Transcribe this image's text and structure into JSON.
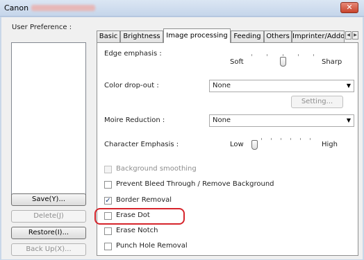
{
  "window": {
    "title": "Canon",
    "close_symbol": "✕"
  },
  "left": {
    "label": "User Preference :",
    "buttons": [
      {
        "label": "Save(Y)...",
        "enabled": true
      },
      {
        "label": "Delete(J)",
        "enabled": false
      },
      {
        "label": "Restore(I)...",
        "enabled": true
      },
      {
        "label": "Back Up(X)...",
        "enabled": false
      }
    ]
  },
  "tabs": [
    {
      "label": "Basic",
      "active": false
    },
    {
      "label": "Brightness",
      "active": false
    },
    {
      "label": "Image processing",
      "active": true
    },
    {
      "label": "Feeding",
      "active": false
    },
    {
      "label": "Others",
      "active": false
    },
    {
      "label": "Imprinter/Addo",
      "active": false
    }
  ],
  "tab_scroll": {
    "left": "◀",
    "right": "▶"
  },
  "panel": {
    "edge_emphasis": {
      "label": "Edge emphasis :",
      "min_label": "Soft",
      "max_label": "Sharp",
      "level": 0.5
    },
    "color_dropout": {
      "label": "Color drop-out :",
      "value": "None",
      "setting_label": "Setting..."
    },
    "moire_reduction": {
      "label": "Moire Reduction :",
      "value": "None"
    },
    "character_emphasis": {
      "label": "Character Emphasis :",
      "min_label": "Low",
      "max_label": "High",
      "level": 0.0
    },
    "checkboxes": [
      {
        "label": "Background smoothing",
        "checked": false,
        "enabled": false
      },
      {
        "label": "Prevent Bleed Through / Remove Background",
        "checked": false,
        "enabled": true
      },
      {
        "label": "Border Removal",
        "checked": true,
        "enabled": true
      },
      {
        "label": "Erase Dot",
        "checked": false,
        "enabled": true
      },
      {
        "label": "Erase Notch",
        "checked": false,
        "enabled": true
      },
      {
        "label": "Punch Hole Removal",
        "checked": false,
        "enabled": true
      }
    ],
    "arrow_glyph": "▼",
    "check_glyph": "✓"
  },
  "colors": {
    "highlight": "#d6242b",
    "check": "#1b3e78"
  }
}
